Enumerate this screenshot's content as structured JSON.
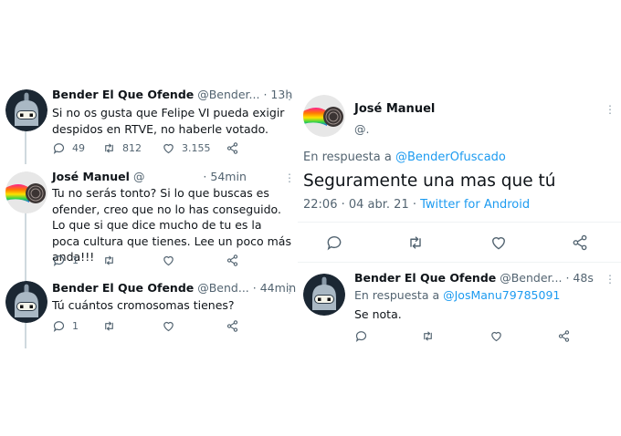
{
  "left": {
    "tweets": [
      {
        "name": "Bender El Que Ofende",
        "handle": "@Bender...",
        "dot": "·",
        "time": "13h",
        "text": "Si no os gusta que Felipe VI pueda exigir despidos en RTVE,  no haberle votado.",
        "replies": "49",
        "retweets": "812",
        "likes": "3.155"
      },
      {
        "name": "José Manuel",
        "handle": "@",
        "dot": "·",
        "time": "54min",
        "text": "Tu no serás tonto? Si lo que buscas es ofender, creo que no lo has conseguido. Lo que si que dice mucho de tu es la poca cultura que tienes. Lee un poco más anda!!!",
        "replies": "1"
      },
      {
        "name": "Bender El Que Ofende",
        "handle": "@Bend...",
        "dot": "·",
        "time": "44min",
        "text": "Tú cuántos cromosomas tienes?",
        "replies": "1"
      }
    ]
  },
  "right": {
    "main": {
      "name": "José Manuel",
      "handle": "@.",
      "reply_prefix": "En respuesta a",
      "reply_to": "@BenderOfuscado",
      "text": "Seguramente una mas que tú",
      "timestamp": "22:06 · 04 abr. 21",
      "dot": "·",
      "client": "Twitter for Android"
    },
    "reply": {
      "name": "Bender El Que Ofende",
      "handle": "@Bender...",
      "dot": "·",
      "time": "48s",
      "reply_prefix": "En respuesta a",
      "reply_to": "@JosManu79785091",
      "text": "Se nota."
    }
  },
  "icons": {
    "reply": "reply-icon",
    "retweet": "retweet-icon",
    "like": "heart-icon",
    "share": "share-icon",
    "more": "more-options-icon"
  },
  "colors": {
    "link": "#1d9bf0",
    "muted": "#536471",
    "line": "#cfd9de"
  }
}
